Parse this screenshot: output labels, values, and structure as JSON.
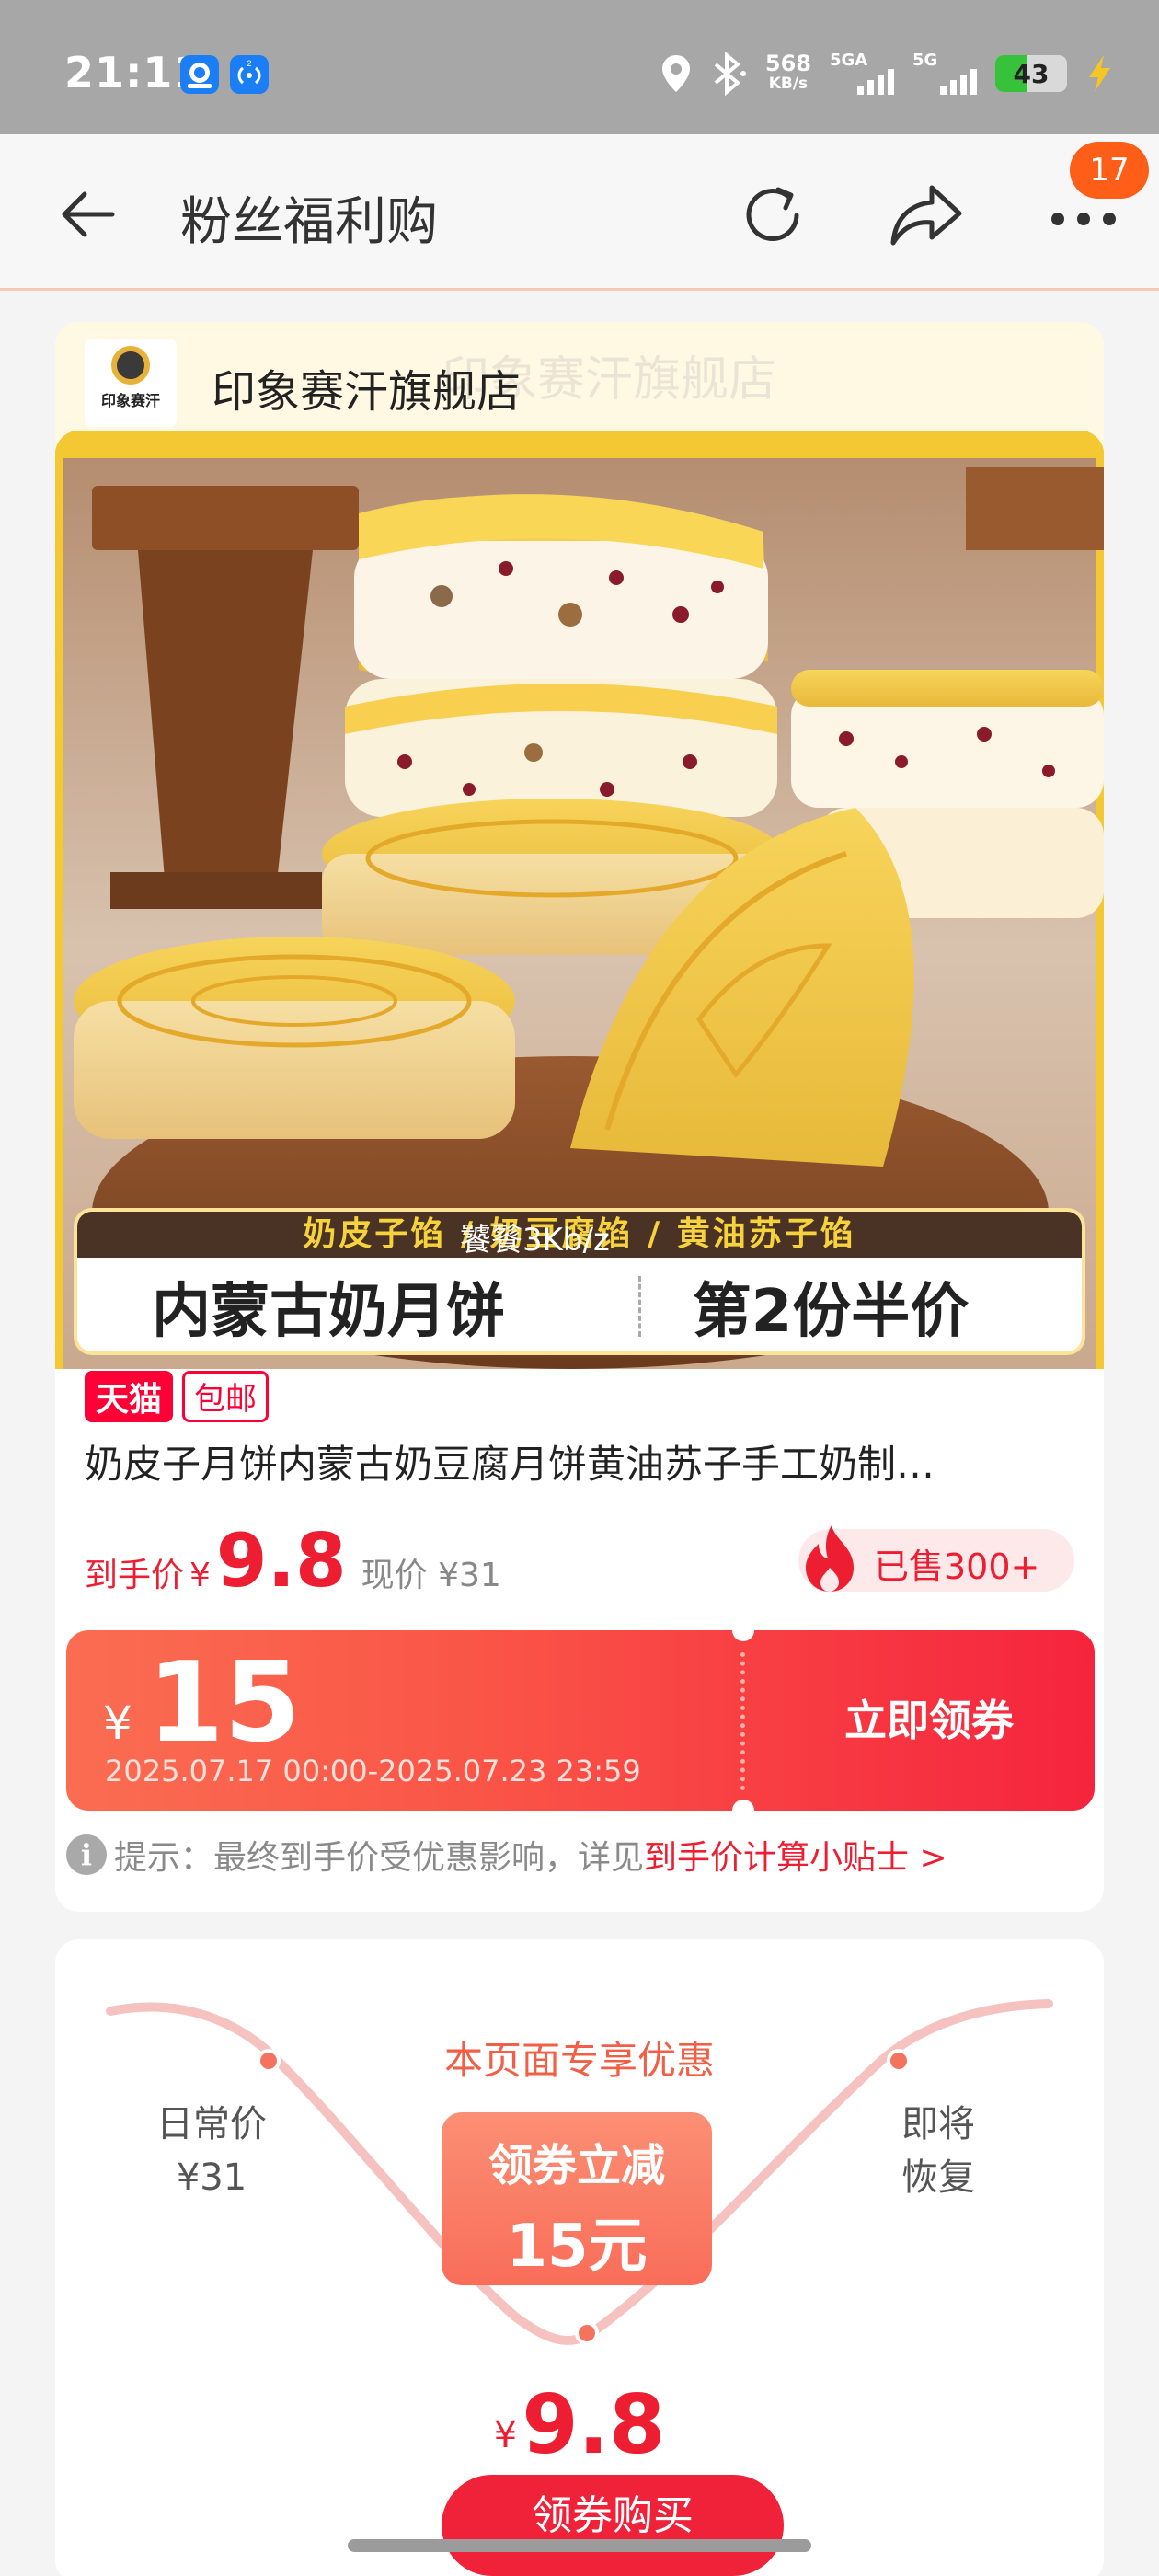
{
  "status_bar": {
    "time": "21:11",
    "net_speed": "568",
    "net_unit": "KB/s",
    "sim1_label": "5GA",
    "sim2_label": "5G",
    "battery": "43",
    "battery_level_percent": 43,
    "icons": [
      "app-icon",
      "nfc-app-icon",
      "location-icon",
      "bluetooth-icon",
      "signal-icon",
      "battery-icon",
      "charging-icon"
    ]
  },
  "header": {
    "title": "粉丝福利购",
    "badge_count": "17",
    "icons": [
      "back-arrow-icon",
      "refresh-icon",
      "share-icon",
      "more-icon"
    ]
  },
  "store": {
    "name": "印象赛汗旗舰店",
    "logo_text": "印象赛汗",
    "ghost_text": "印象赛汗旗舰店"
  },
  "product_image": {
    "flavors": "奶皮子馅 / 奶豆腐馅 / 黄油苏子馅",
    "headline_left": "内蒙古奶月饼",
    "headline_right": "第2份半价",
    "watermark": "饕餮3Kb/z"
  },
  "product": {
    "tag_tmall": "天猫",
    "tag_shipping": "包邮",
    "title": "奶皮子月饼内蒙古奶豆腐月饼黄油苏子手工奶制…",
    "price_label": "到手价",
    "currency": "¥",
    "price": "9.8",
    "original_price": "现价 ¥31",
    "sold": "已售300+"
  },
  "coupon": {
    "currency": "¥",
    "amount": "15",
    "validity": "2025.07.17 00:00-2025.07.23 23:59",
    "claim_label": "立即领券"
  },
  "hint": {
    "icon_text": "i",
    "text": "提示：最终到手价受优惠影响，详见",
    "link": "到手价计算小贴士 >"
  },
  "promo": {
    "title": "本页面专享优惠",
    "daily_label": "日常价",
    "daily_price": "¥31",
    "restore_line1": "即将",
    "restore_line2": "恢复",
    "cut_line1": "领券立减",
    "cut_line2": "15元",
    "final_currency": "¥",
    "final_price": "9.8",
    "buy_label": "领券购买"
  },
  "colors": {
    "accent_red": "#ee1e32",
    "coupon_orange": "#fa5547",
    "badge_orange": "#fe5e17",
    "header_bg": "#f7f7f7",
    "status_bg": "#a7a7a7"
  }
}
